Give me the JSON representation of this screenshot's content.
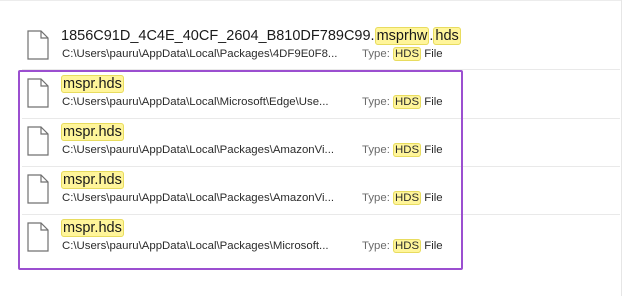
{
  "results": [
    {
      "name_parts": [
        "1856C91D_4C4E_40CF_2604_B810DF789C99.",
        "msprhw",
        ".",
        "hds"
      ],
      "path": "C:\\Users\\pauru\\AppData\\Local\\Packages\\4DF9E0F8...",
      "type_label": "Type:",
      "type_highlight": "HDS",
      "type_suffix": "File",
      "icon": "generic-file-icon"
    },
    {
      "name_parts": [
        "mspr.hds"
      ],
      "path": "C:\\Users\\pauru\\AppData\\Local\\Microsoft\\Edge\\Use...",
      "type_label": "Type:",
      "type_highlight": "HDS",
      "type_suffix": "File",
      "icon": "generic-file-icon"
    },
    {
      "name_parts": [
        "mspr.hds"
      ],
      "path": "C:\\Users\\pauru\\AppData\\Local\\Packages\\AmazonVi...",
      "type_label": "Type:",
      "type_highlight": "HDS",
      "type_suffix": "File",
      "icon": "generic-file-icon"
    },
    {
      "name_parts": [
        "mspr.hds"
      ],
      "path": "C:\\Users\\pauru\\AppData\\Local\\Packages\\AmazonVi...",
      "type_label": "Type:",
      "type_highlight": "HDS",
      "type_suffix": "File",
      "icon": "generic-file-icon"
    },
    {
      "name_parts": [
        "mspr.hds"
      ],
      "path": "C:\\Users\\pauru\\AppData\\Local\\Packages\\Microsoft...",
      "type_label": "Type:",
      "type_highlight": "HDS",
      "type_suffix": "File",
      "icon": "generic-file-icon"
    }
  ],
  "colors": {
    "highlight": "#fff59a",
    "selection_outline": "#9b4fd0"
  }
}
